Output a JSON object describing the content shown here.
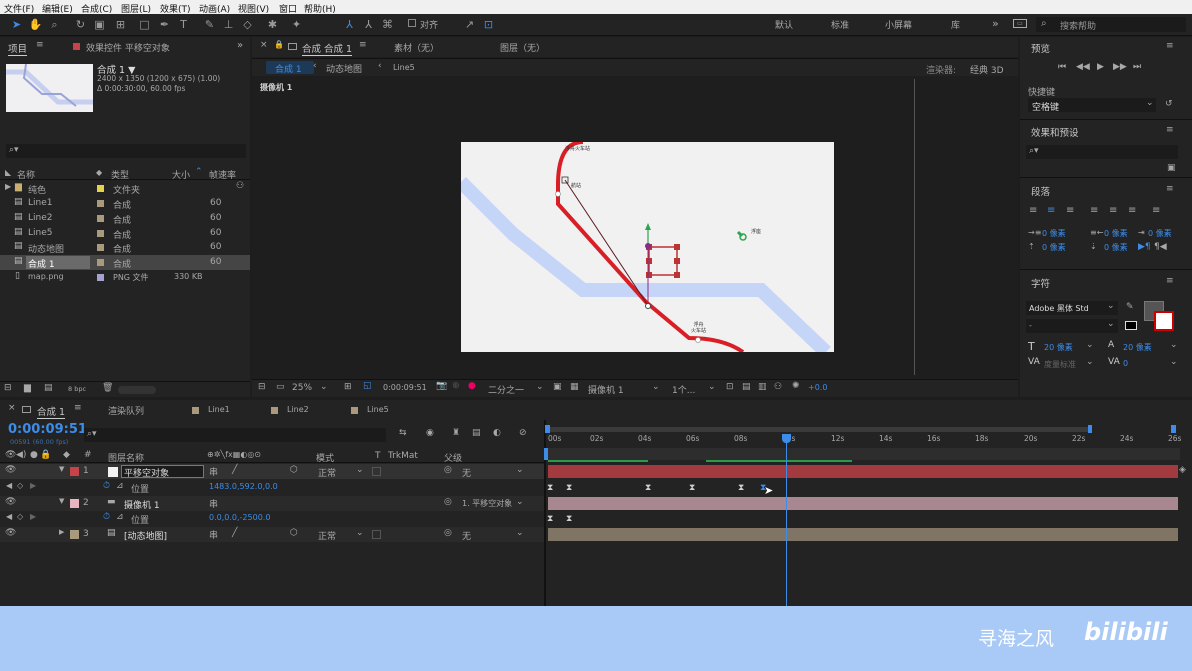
{
  "menu": [
    "文件(F)",
    "编辑(E)",
    "合成(C)",
    "图层(L)",
    "效果(T)",
    "动画(A)",
    "视图(V)",
    "窗口",
    "帮助(H)"
  ],
  "toolbar": {
    "align": "对齐",
    "workspaces": [
      "默认",
      "标准",
      "小屏幕",
      "库"
    ],
    "search_placeholder": "搜索帮助"
  },
  "project": {
    "tab": "项目",
    "effects_tab": "效果控件 平移空对象",
    "comp_name": "合成 1 ▼",
    "comp_info1": "2400 x 1350 (1200 x 675) (1.00)",
    "comp_info2": "Δ 0:00:30:00, 60.00 fps",
    "search_placeholder": "⌕▾",
    "col_name": "名称",
    "col_type": "类型",
    "col_size": "大小",
    "col_fps": "帧速率",
    "items": [
      {
        "name": "纯色",
        "type": "文件夹",
        "size": "",
        "fps": "",
        "color": "#e5d24a"
      },
      {
        "name": "Line1",
        "type": "合成",
        "size": "",
        "fps": "60",
        "color": "#a99a7e"
      },
      {
        "name": "Line2",
        "type": "合成",
        "size": "",
        "fps": "60",
        "color": "#a99a7e"
      },
      {
        "name": "Line5",
        "type": "合成",
        "size": "",
        "fps": "60",
        "color": "#a99a7e"
      },
      {
        "name": "动态地图",
        "type": "合成",
        "size": "",
        "fps": "60",
        "color": "#a99a7e"
      },
      {
        "name": "合成 1",
        "type": "合成",
        "size": "",
        "fps": "60",
        "color": "#a99a7e"
      },
      {
        "name": "map.png",
        "type": "PNG 文件",
        "size": "330 KB",
        "fps": "",
        "color": "#a6a2cf"
      }
    ],
    "bpc": "8 bpc"
  },
  "viewer": {
    "tab": "合成 合成 1",
    "footage_tab": "素材（无）",
    "layer_tab": "图层（无）",
    "crumbs": [
      "合成 1",
      "动态地图",
      "Line5"
    ],
    "renderer_label": "渲染器:",
    "renderer": "经典 3D",
    "camera_label": "摄像机 1",
    "map_labels": [
      "浮舟火车站",
      "航站",
      "浮舟\n火车站",
      "浮座"
    ],
    "zoom": "25%",
    "timecode": "0:00:09:51",
    "resolution": "二分之一",
    "view": "摄像机 1",
    "views": "1个...",
    "exposure": "+0.0"
  },
  "right": {
    "preview": "预览",
    "shortcut_label": "快捷键",
    "shortcut": "空格键",
    "effects": "效果和预设",
    "effects_search": "⌕▾",
    "paragraph": "段落",
    "indents": [
      "0 像素",
      "0 像素",
      "0 像素",
      "0 像素",
      "0 像素"
    ],
    "character": "字符",
    "font": "Adobe 黑体 Std",
    "style": "-",
    "font_size": "20 像素",
    "leading": "20 像素",
    "kerning": "度量标准",
    "tracking": "0"
  },
  "timeline": {
    "tab": "合成 1",
    "render_queue": "渲染队列",
    "tabs": [
      "Line1",
      "Line2",
      "Line5"
    ],
    "timecode": "0:00:09:51",
    "timecode_sub": "00591 (60.00 fps)",
    "headers": {
      "name": "图层名称",
      "mode": "模式",
      "t": "T",
      "trkmat": "TrkMat",
      "parent": "父级"
    },
    "ruler": [
      "00s",
      "02s",
      "04s",
      "06s",
      "08s",
      "10s",
      "12s",
      "14s",
      "16s",
      "18s",
      "20s",
      "22s",
      "24s",
      "26s"
    ],
    "layers": [
      {
        "num": "1",
        "name": "平移空对象",
        "mode": "正常",
        "parent": "无",
        "color": "#c6434a",
        "swatch": "#f2f2f2"
      },
      {
        "num": "",
        "name": "位置",
        "value": "1483.0,592.0,0.0"
      },
      {
        "num": "2",
        "name": "摄像机 1",
        "parent": "1. 平移空对象",
        "color": "#e9b6c0"
      },
      {
        "num": "",
        "name": "位置",
        "value": "0.0,0.0,-2500.0"
      },
      {
        "num": "3",
        "name": "[动态地图]",
        "mode": "正常",
        "parent": "无",
        "color": "#a99a7e"
      }
    ]
  },
  "watermark": {
    "author": "寻海之风",
    "site": "bilibili"
  }
}
